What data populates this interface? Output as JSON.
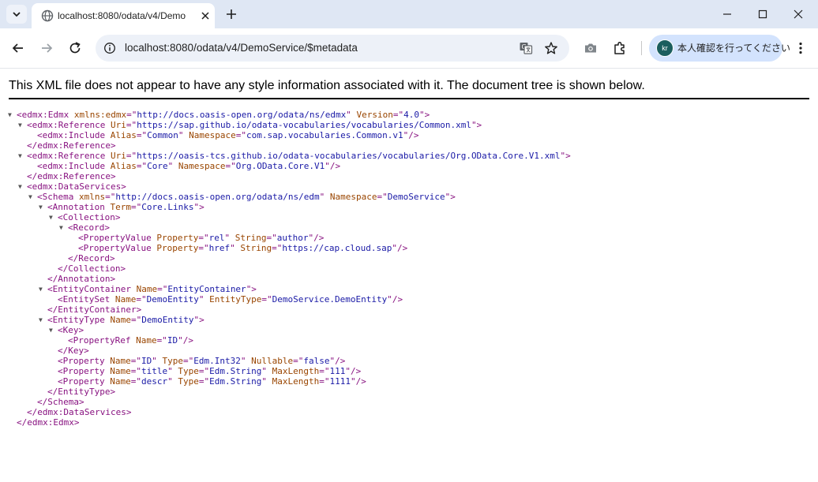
{
  "browser": {
    "tab_title": "localhost:8080/odata/v4/Demo",
    "url": "localhost:8080/odata/v4/DemoService/$metadata",
    "profile_label": "本人確認を行ってください",
    "profile_initials": "kr"
  },
  "page": {
    "notice": "This XML file does not appear to have any style information associated with it. The document tree is shown below."
  },
  "xml_lines": [
    {
      "indent": 0,
      "toggle": true,
      "parts": [
        [
          "t",
          "<edmx:Edmx"
        ],
        [
          "s",
          " "
        ],
        [
          "a",
          "xmlns:edmx"
        ],
        [
          "t",
          "=\""
        ],
        [
          "v",
          "http://docs.oasis-open.org/odata/ns/edmx"
        ],
        [
          "t",
          "\""
        ],
        [
          "s",
          " "
        ],
        [
          "a",
          "Version"
        ],
        [
          "t",
          "=\""
        ],
        [
          "v",
          "4.0"
        ],
        [
          "t",
          "\">"
        ]
      ]
    },
    {
      "indent": 1,
      "toggle": true,
      "parts": [
        [
          "t",
          "<edmx:Reference"
        ],
        [
          "s",
          " "
        ],
        [
          "a",
          "Uri"
        ],
        [
          "t",
          "=\""
        ],
        [
          "v",
          "https://sap.github.io/odata-vocabularies/vocabularies/Common.xml"
        ],
        [
          "t",
          "\">"
        ]
      ]
    },
    {
      "indent": 2,
      "toggle": false,
      "parts": [
        [
          "t",
          "<edmx:Include"
        ],
        [
          "s",
          " "
        ],
        [
          "a",
          "Alias"
        ],
        [
          "t",
          "=\""
        ],
        [
          "v",
          "Common"
        ],
        [
          "t",
          "\""
        ],
        [
          "s",
          " "
        ],
        [
          "a",
          "Namespace"
        ],
        [
          "t",
          "=\""
        ],
        [
          "v",
          "com.sap.vocabularies.Common.v1"
        ],
        [
          "t",
          "\"/>"
        ]
      ]
    },
    {
      "indent": 1,
      "toggle": false,
      "parts": [
        [
          "t",
          "</edmx:Reference>"
        ]
      ]
    },
    {
      "indent": 1,
      "toggle": true,
      "parts": [
        [
          "t",
          "<edmx:Reference"
        ],
        [
          "s",
          " "
        ],
        [
          "a",
          "Uri"
        ],
        [
          "t",
          "=\""
        ],
        [
          "v",
          "https://oasis-tcs.github.io/odata-vocabularies/vocabularies/Org.OData.Core.V1.xml"
        ],
        [
          "t",
          "\">"
        ]
      ]
    },
    {
      "indent": 2,
      "toggle": false,
      "parts": [
        [
          "t",
          "<edmx:Include"
        ],
        [
          "s",
          " "
        ],
        [
          "a",
          "Alias"
        ],
        [
          "t",
          "=\""
        ],
        [
          "v",
          "Core"
        ],
        [
          "t",
          "\""
        ],
        [
          "s",
          " "
        ],
        [
          "a",
          "Namespace"
        ],
        [
          "t",
          "=\""
        ],
        [
          "v",
          "Org.OData.Core.V1"
        ],
        [
          "t",
          "\"/>"
        ]
      ]
    },
    {
      "indent": 1,
      "toggle": false,
      "parts": [
        [
          "t",
          "</edmx:Reference>"
        ]
      ]
    },
    {
      "indent": 1,
      "toggle": true,
      "parts": [
        [
          "t",
          "<edmx:DataServices>"
        ]
      ]
    },
    {
      "indent": 2,
      "toggle": true,
      "parts": [
        [
          "t",
          "<Schema"
        ],
        [
          "s",
          " "
        ],
        [
          "a",
          "xmlns"
        ],
        [
          "t",
          "=\""
        ],
        [
          "v",
          "http://docs.oasis-open.org/odata/ns/edm"
        ],
        [
          "t",
          "\""
        ],
        [
          "s",
          " "
        ],
        [
          "a",
          "Namespace"
        ],
        [
          "t",
          "=\""
        ],
        [
          "v",
          "DemoService"
        ],
        [
          "t",
          "\">"
        ]
      ]
    },
    {
      "indent": 3,
      "toggle": true,
      "parts": [
        [
          "t",
          "<Annotation"
        ],
        [
          "s",
          " "
        ],
        [
          "a",
          "Term"
        ],
        [
          "t",
          "=\""
        ],
        [
          "v",
          "Core.Links"
        ],
        [
          "t",
          "\">"
        ]
      ]
    },
    {
      "indent": 4,
      "toggle": true,
      "parts": [
        [
          "t",
          "<Collection>"
        ]
      ]
    },
    {
      "indent": 5,
      "toggle": true,
      "parts": [
        [
          "t",
          "<Record>"
        ]
      ]
    },
    {
      "indent": 6,
      "toggle": false,
      "parts": [
        [
          "t",
          "<PropertyValue"
        ],
        [
          "s",
          " "
        ],
        [
          "a",
          "Property"
        ],
        [
          "t",
          "=\""
        ],
        [
          "v",
          "rel"
        ],
        [
          "t",
          "\""
        ],
        [
          "s",
          " "
        ],
        [
          "a",
          "String"
        ],
        [
          "t",
          "=\""
        ],
        [
          "v",
          "author"
        ],
        [
          "t",
          "\"/>"
        ]
      ]
    },
    {
      "indent": 6,
      "toggle": false,
      "parts": [
        [
          "t",
          "<PropertyValue"
        ],
        [
          "s",
          " "
        ],
        [
          "a",
          "Property"
        ],
        [
          "t",
          "=\""
        ],
        [
          "v",
          "href"
        ],
        [
          "t",
          "\""
        ],
        [
          "s",
          " "
        ],
        [
          "a",
          "String"
        ],
        [
          "t",
          "=\""
        ],
        [
          "v",
          "https://cap.cloud.sap"
        ],
        [
          "t",
          "\"/>"
        ]
      ]
    },
    {
      "indent": 5,
      "toggle": false,
      "parts": [
        [
          "t",
          "</Record>"
        ]
      ]
    },
    {
      "indent": 4,
      "toggle": false,
      "parts": [
        [
          "t",
          "</Collection>"
        ]
      ]
    },
    {
      "indent": 3,
      "toggle": false,
      "parts": [
        [
          "t",
          "</Annotation>"
        ]
      ]
    },
    {
      "indent": 3,
      "toggle": true,
      "parts": [
        [
          "t",
          "<EntityContainer"
        ],
        [
          "s",
          " "
        ],
        [
          "a",
          "Name"
        ],
        [
          "t",
          "=\""
        ],
        [
          "v",
          "EntityContainer"
        ],
        [
          "t",
          "\">"
        ]
      ]
    },
    {
      "indent": 4,
      "toggle": false,
      "parts": [
        [
          "t",
          "<EntitySet"
        ],
        [
          "s",
          " "
        ],
        [
          "a",
          "Name"
        ],
        [
          "t",
          "=\""
        ],
        [
          "v",
          "DemoEntity"
        ],
        [
          "t",
          "\""
        ],
        [
          "s",
          " "
        ],
        [
          "a",
          "EntityType"
        ],
        [
          "t",
          "=\""
        ],
        [
          "v",
          "DemoService.DemoEntity"
        ],
        [
          "t",
          "\"/>"
        ]
      ]
    },
    {
      "indent": 3,
      "toggle": false,
      "parts": [
        [
          "t",
          "</EntityContainer>"
        ]
      ]
    },
    {
      "indent": 3,
      "toggle": true,
      "parts": [
        [
          "t",
          "<EntityType"
        ],
        [
          "s",
          " "
        ],
        [
          "a",
          "Name"
        ],
        [
          "t",
          "=\""
        ],
        [
          "v",
          "DemoEntity"
        ],
        [
          "t",
          "\">"
        ]
      ]
    },
    {
      "indent": 4,
      "toggle": true,
      "parts": [
        [
          "t",
          "<Key>"
        ]
      ]
    },
    {
      "indent": 5,
      "toggle": false,
      "parts": [
        [
          "t",
          "<PropertyRef"
        ],
        [
          "s",
          " "
        ],
        [
          "a",
          "Name"
        ],
        [
          "t",
          "=\""
        ],
        [
          "v",
          "ID"
        ],
        [
          "t",
          "\"/>"
        ]
      ]
    },
    {
      "indent": 4,
      "toggle": false,
      "parts": [
        [
          "t",
          "</Key>"
        ]
      ]
    },
    {
      "indent": 4,
      "toggle": false,
      "parts": [
        [
          "t",
          "<Property"
        ],
        [
          "s",
          " "
        ],
        [
          "a",
          "Name"
        ],
        [
          "t",
          "=\""
        ],
        [
          "v",
          "ID"
        ],
        [
          "t",
          "\""
        ],
        [
          "s",
          " "
        ],
        [
          "a",
          "Type"
        ],
        [
          "t",
          "=\""
        ],
        [
          "v",
          "Edm.Int32"
        ],
        [
          "t",
          "\""
        ],
        [
          "s",
          " "
        ],
        [
          "a",
          "Nullable"
        ],
        [
          "t",
          "=\""
        ],
        [
          "v",
          "false"
        ],
        [
          "t",
          "\"/>"
        ]
      ]
    },
    {
      "indent": 4,
      "toggle": false,
      "parts": [
        [
          "t",
          "<Property"
        ],
        [
          "s",
          " "
        ],
        [
          "a",
          "Name"
        ],
        [
          "t",
          "=\""
        ],
        [
          "v",
          "title"
        ],
        [
          "t",
          "\""
        ],
        [
          "s",
          " "
        ],
        [
          "a",
          "Type"
        ],
        [
          "t",
          "=\""
        ],
        [
          "v",
          "Edm.String"
        ],
        [
          "t",
          "\""
        ],
        [
          "s",
          " "
        ],
        [
          "a",
          "MaxLength"
        ],
        [
          "t",
          "=\""
        ],
        [
          "v",
          "111"
        ],
        [
          "t",
          "\"/>"
        ]
      ]
    },
    {
      "indent": 4,
      "toggle": false,
      "parts": [
        [
          "t",
          "<Property"
        ],
        [
          "s",
          " "
        ],
        [
          "a",
          "Name"
        ],
        [
          "t",
          "=\""
        ],
        [
          "v",
          "descr"
        ],
        [
          "t",
          "\""
        ],
        [
          "s",
          " "
        ],
        [
          "a",
          "Type"
        ],
        [
          "t",
          "=\""
        ],
        [
          "v",
          "Edm.String"
        ],
        [
          "t",
          "\""
        ],
        [
          "s",
          " "
        ],
        [
          "a",
          "MaxLength"
        ],
        [
          "t",
          "=\""
        ],
        [
          "v",
          "1111"
        ],
        [
          "t",
          "\"/>"
        ]
      ]
    },
    {
      "indent": 3,
      "toggle": false,
      "parts": [
        [
          "t",
          "</EntityType>"
        ]
      ]
    },
    {
      "indent": 2,
      "toggle": false,
      "parts": [
        [
          "t",
          "</Schema>"
        ]
      ]
    },
    {
      "indent": 1,
      "toggle": false,
      "parts": [
        [
          "t",
          "</edmx:DataServices>"
        ]
      ]
    },
    {
      "indent": 0,
      "toggle": false,
      "parts": [
        [
          "t",
          "</edmx:Edmx>"
        ]
      ]
    }
  ]
}
